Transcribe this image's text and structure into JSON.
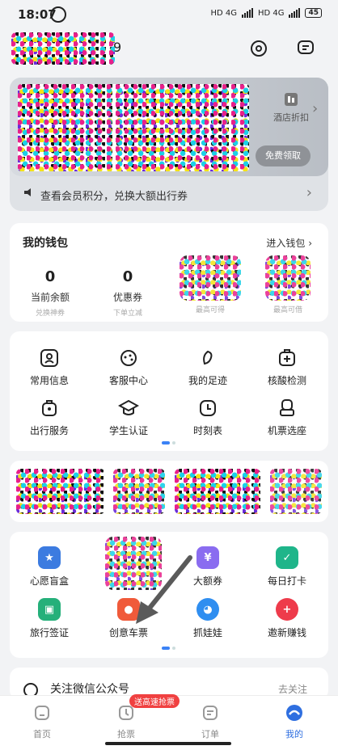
{
  "status_bar": {
    "time": "18:07",
    "network_1": "HD 4G",
    "network_2": "HD 4G",
    "battery": "45"
  },
  "header": {
    "name_suffix": "9",
    "icons": [
      "settings-icon",
      "message-icon"
    ]
  },
  "banner": {
    "side_label": "酒店折扣",
    "button_label": "免费领取",
    "member_text": "查看会员积分，兑换大额出行券"
  },
  "wallet": {
    "title": "我的钱包",
    "link": "进入钱包",
    "stats": [
      {
        "value": "0",
        "label": "当前余额",
        "sub": "兑换神券"
      },
      {
        "value": "0",
        "label": "优惠券",
        "sub": "下单立减"
      }
    ],
    "obscured": [
      {
        "sub": "最高可得"
      },
      {
        "sub": "最高可借"
      }
    ]
  },
  "services": {
    "items": [
      {
        "label": "常用信息",
        "icon": "id-card-icon"
      },
      {
        "label": "客服中心",
        "icon": "headset-icon"
      },
      {
        "label": "我的足迹",
        "icon": "footprint-icon"
      },
      {
        "label": "核酸检测",
        "icon": "medical-icon"
      },
      {
        "label": "出行服务",
        "icon": "luggage-icon"
      },
      {
        "label": "学生认证",
        "icon": "graduation-icon"
      },
      {
        "label": "时刻表",
        "icon": "clock-icon"
      },
      {
        "label": "机票选座",
        "icon": "seat-icon"
      }
    ]
  },
  "apps": {
    "items": [
      {
        "label": "心愿盲盒",
        "icon": "gift-box-icon",
        "color": "#3c7be0"
      },
      {
        "label": "",
        "icon": "",
        "color": ""
      },
      {
        "label": "大额券",
        "icon": "coupon-icon",
        "color": "#8a6cf0"
      },
      {
        "label": "每日打卡",
        "icon": "checkin-icon",
        "color": "#1fb58a"
      },
      {
        "label": "旅行签证",
        "icon": "visa-icon",
        "color": "#25b07a"
      },
      {
        "label": "创意车票",
        "icon": "ticket-art-icon",
        "color": "#f05a3a"
      },
      {
        "label": "抓娃娃",
        "icon": "claw-bear-icon",
        "color": "#2f8ef0"
      },
      {
        "label": "邀新赚钱",
        "icon": "invite-icon",
        "color": "#ee3b4b"
      }
    ]
  },
  "follow": {
    "text": "关注微信公众号",
    "action": "去关注"
  },
  "tabbar": {
    "promo_badge": "送高速抢票",
    "tabs": [
      {
        "label": "首页",
        "icon": "home-icon",
        "active": false
      },
      {
        "label": "抢票",
        "icon": "rush-ticket-icon",
        "active": false
      },
      {
        "label": "订单",
        "icon": "order-icon",
        "active": false
      },
      {
        "label": "我的",
        "icon": "profile-icon",
        "active": true
      }
    ],
    "active_color": "#2f6fe0"
  }
}
